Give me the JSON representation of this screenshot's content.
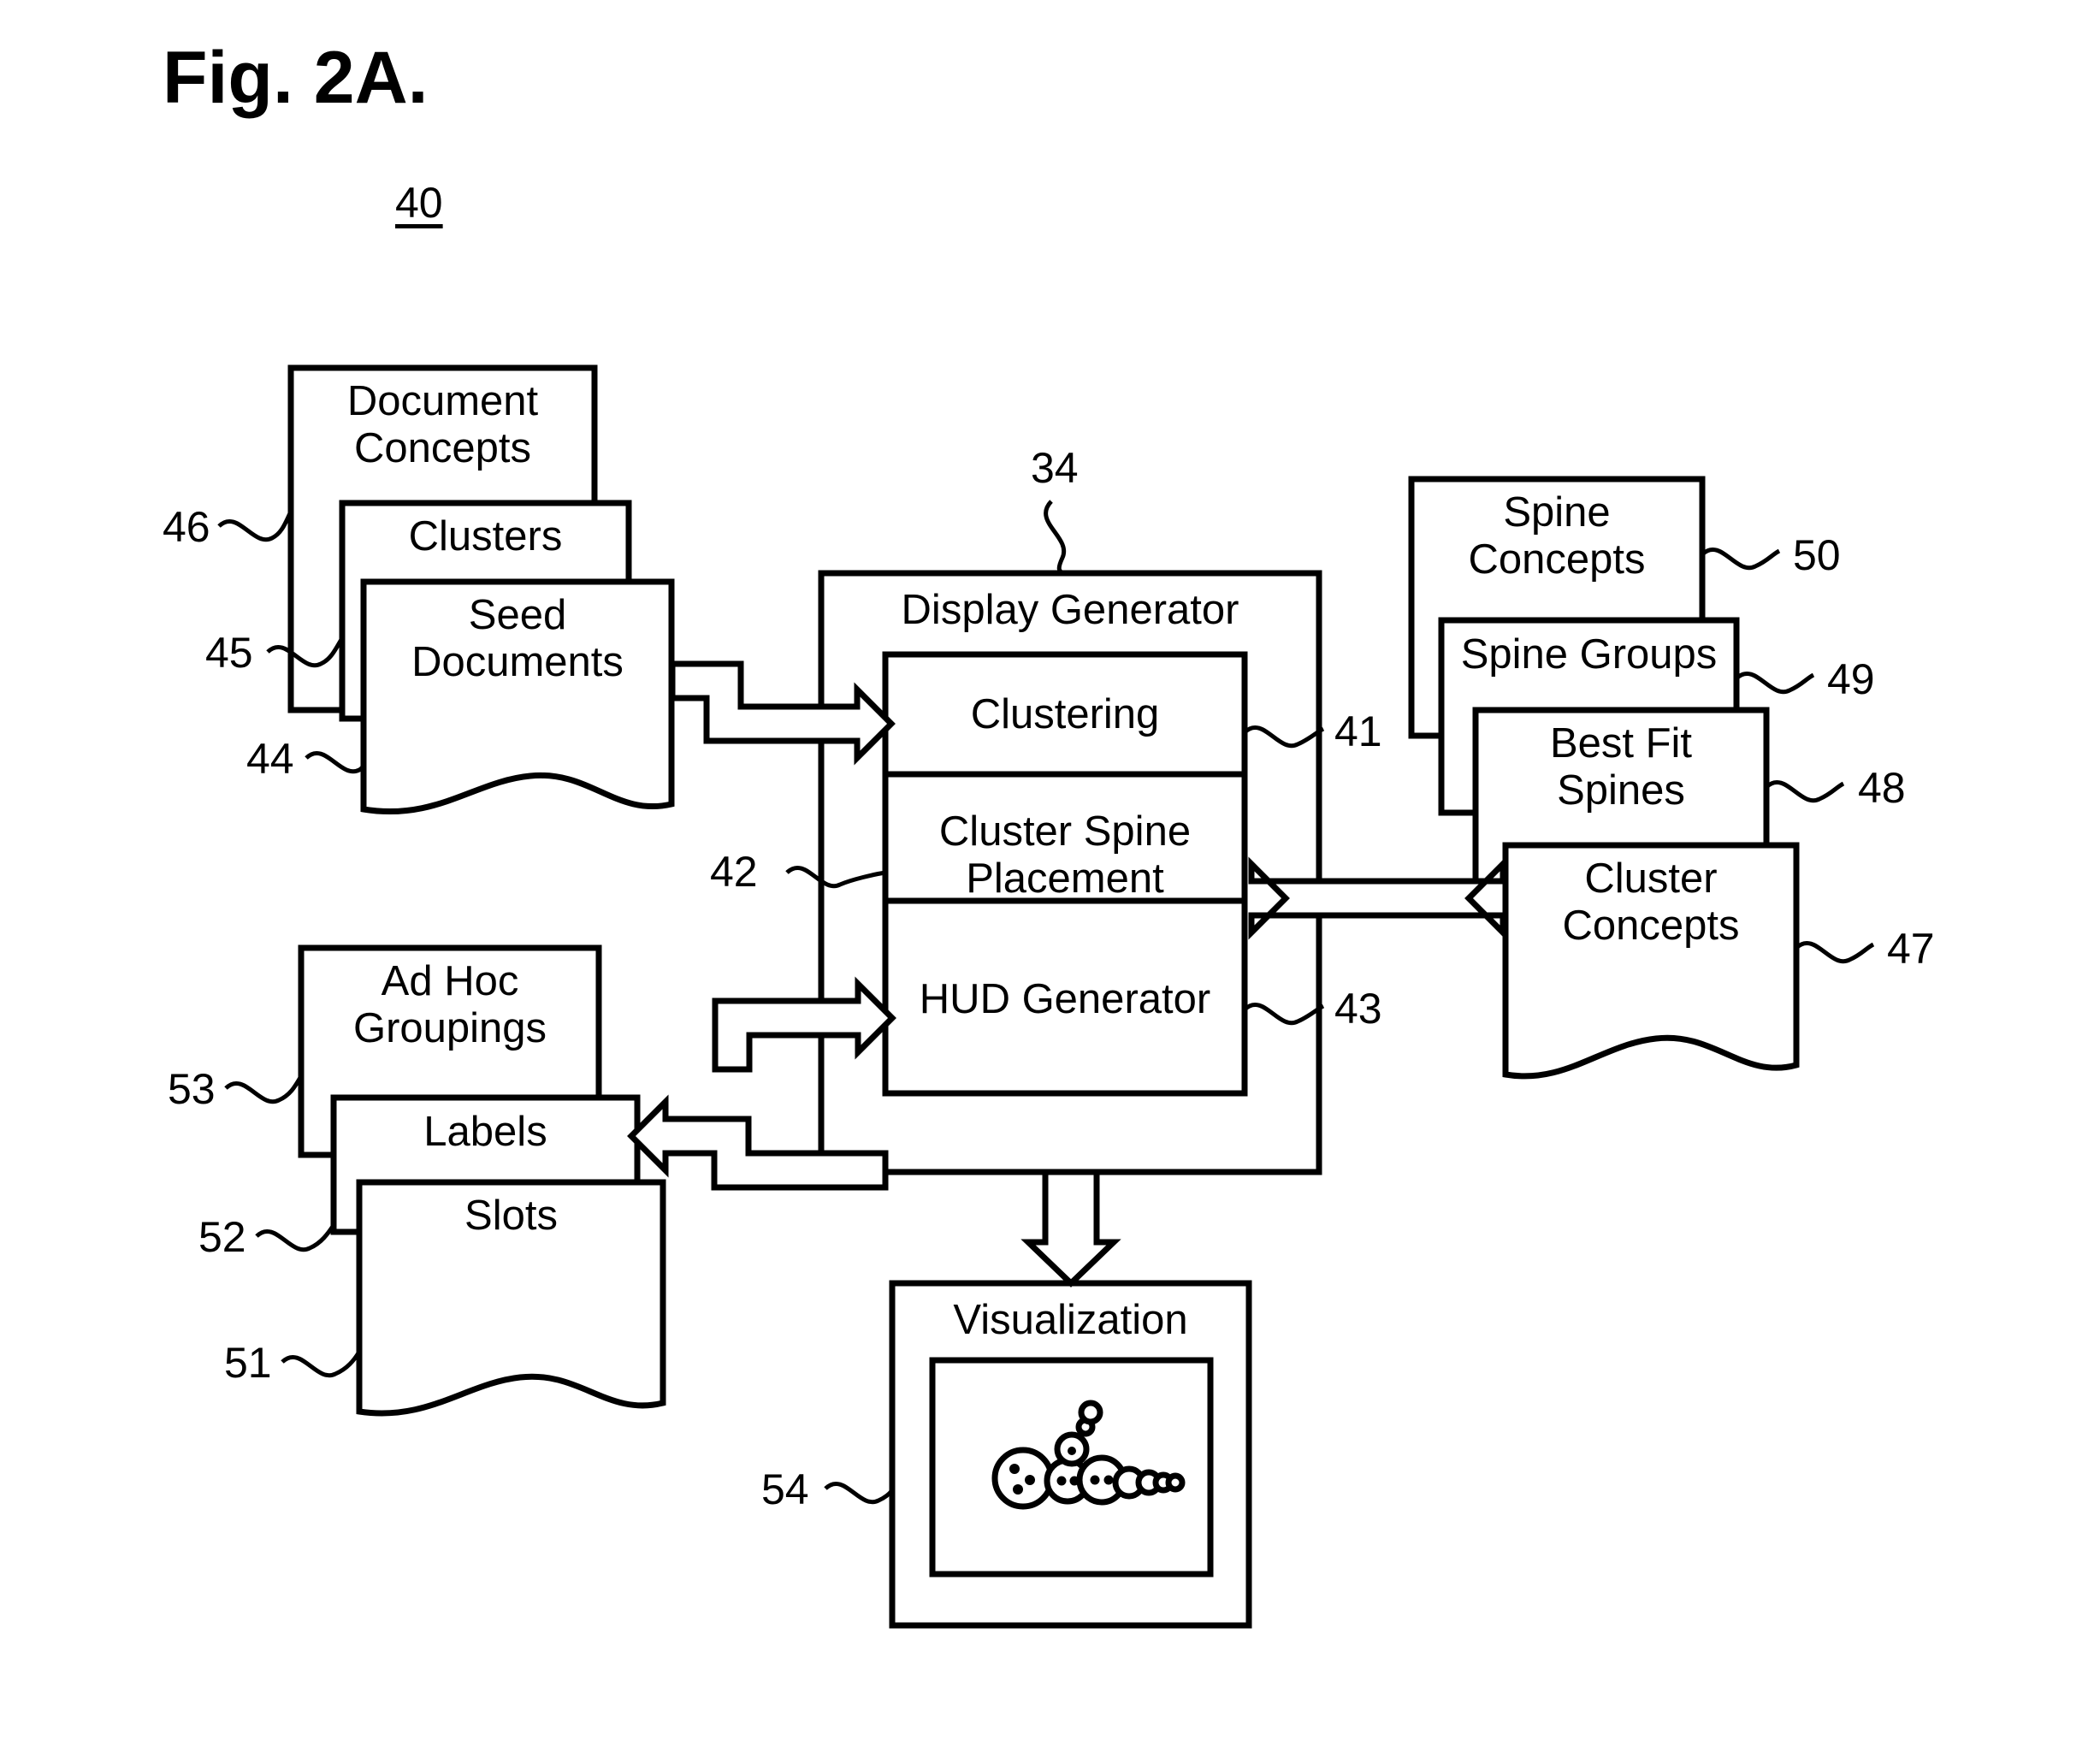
{
  "figure": {
    "title": "Fig. 2A.",
    "system_number": "40"
  },
  "display_generator": {
    "title": "Display Generator",
    "ref": "34",
    "modules": [
      {
        "label": "Clustering",
        "ref": "41"
      },
      {
        "label": "Cluster Spine\nPlacement",
        "ref": "42"
      },
      {
        "label": "HUD Generator",
        "ref": "43"
      }
    ]
  },
  "input_stack": {
    "items": [
      {
        "label": "Document\nConcepts",
        "ref": "46"
      },
      {
        "label": "Clusters",
        "ref": "45"
      },
      {
        "label": "Seed\nDocuments",
        "ref": "44"
      }
    ]
  },
  "spine_stack": {
    "items": [
      {
        "label": "Spine\nConcepts",
        "ref": "50"
      },
      {
        "label": "Spine Groups",
        "ref": "49"
      },
      {
        "label": "Best Fit\nSpines",
        "ref": "48"
      },
      {
        "label": "Cluster\nConcepts",
        "ref": "47"
      }
    ]
  },
  "hud_stack": {
    "items": [
      {
        "label": "Ad Hoc\nGroupings",
        "ref": "53"
      },
      {
        "label": "Labels",
        "ref": "52"
      },
      {
        "label": "Slots",
        "ref": "51"
      }
    ]
  },
  "visualization": {
    "label": "Visualization",
    "ref": "54"
  },
  "colors": {
    "stroke": "#000000",
    "fill": "#ffffff"
  }
}
